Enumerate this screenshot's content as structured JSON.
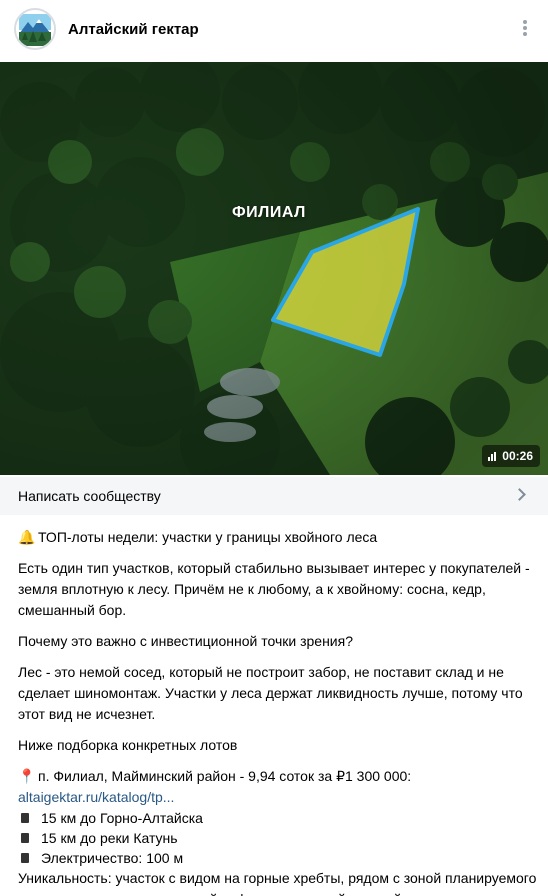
{
  "header": {
    "group_name": "Алтайский гектар",
    "avatar_icon": "mountain-logo-icon",
    "more_icon": "more-vertical-icon"
  },
  "video": {
    "overlay_label": "ФИЛИАЛ",
    "duration": "00:26",
    "colors": {
      "plot_fill": "#e8e040",
      "plot_border": "#2aa6e6"
    }
  },
  "write_bar": {
    "label": "Написать сообществу",
    "icon": "chevron-right-icon"
  },
  "post": {
    "headline_emoji": "🔔",
    "headline": "ТОП-лоты недели: участки у границы хвойного леса",
    "p1": "Есть один тип участков, который стабильно вызывает интерес у покупателей - земля вплотную к лесу. Причём не к любому, а к хвойному: сосна, кедр, смешанный бор.",
    "p2": "Почему это важно с инвестиционной точки зрения?",
    "p3": "Лес - это немой сосед, который не построит забор, не поставит склад и не сделает шиномонтаж. Участки у леса держат ликвидность лучше, потому что этот вид не исчезнет.",
    "p4": "Ниже подборка конкретных лотов",
    "lot_emoji": "📍",
    "lot_title": "п. Филиал, Майминский район - 9,94 соток за ₽1 300 000:",
    "lot_link": "altaigektar.ru/katalog/tp...",
    "features": [
      "15 км до Горно-Алтайска",
      "15 км до реки Катунь",
      "Электричество: 100 м"
    ],
    "uniqueness": "Уникальность: участок с видом на горные хребты, рядом с зоной планируемого горнолыжного курорта и новой асфальтированной дорогой."
  }
}
